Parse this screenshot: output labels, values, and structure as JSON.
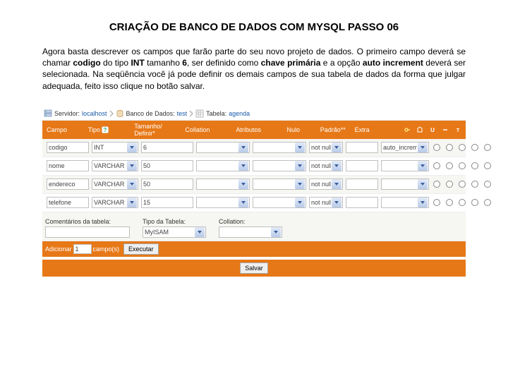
{
  "doc": {
    "title": "CRIAÇÃO DE BANCO DE DADOS COM MYSQL PASSO 06",
    "para_pre": "Agora basta descrever os campos que farão parte do seu novo projeto de dados. O primeiro campo deverá se chamar ",
    "b1": "codigo",
    "mid1": " do tipo ",
    "b2": "INT",
    "mid2": " tamanho ",
    "b3": "6",
    "mid3": ", ser definido como ",
    "b4": "chave primária",
    "mid4": " e a opção ",
    "b5": "auto increment",
    "tail": " deverá ser selecionada. Na seqüência você já pode definir os demais campos de sua tabela de dados da forma que julgar adequada, feito isso clique no botão salvar."
  },
  "breadcrumb": {
    "server_label": "Servidor:",
    "server": "localhost",
    "db_label": "Banco de Dados:",
    "db": "test",
    "tbl_label": "Tabela:",
    "tbl": "agenda"
  },
  "headers": {
    "campo": "Campo",
    "tipo": "Tipo",
    "tam": "Tamanho/ Definir*",
    "coll": "Collation",
    "attr": "Atributos",
    "null": "Nulo",
    "padrao": "Padrão**",
    "extra": "Extra"
  },
  "rows": [
    {
      "campo": "codigo",
      "tipo": "INT",
      "tam": "6",
      "null": "not null",
      "extra": "auto_increment"
    },
    {
      "campo": "nome",
      "tipo": "VARCHAR",
      "tam": "50",
      "null": "not null",
      "extra": ""
    },
    {
      "campo": "endereco",
      "tipo": "VARCHAR",
      "tam": "50",
      "null": "not null",
      "extra": ""
    },
    {
      "campo": "telefone",
      "tipo": "VARCHAR",
      "tam": "15",
      "null": "not null",
      "extra": ""
    }
  ],
  "low": {
    "comentarios_label": "Comentários da tabela:",
    "tipo_label": "Tipo da Tabela:",
    "tipo_val": "MyISAM",
    "coll_label": "Collation:"
  },
  "add": {
    "pre": "Adicionar",
    "count": "1",
    "post": "campo(s)",
    "exec": "Executar"
  },
  "save": {
    "label": "Salvar"
  }
}
